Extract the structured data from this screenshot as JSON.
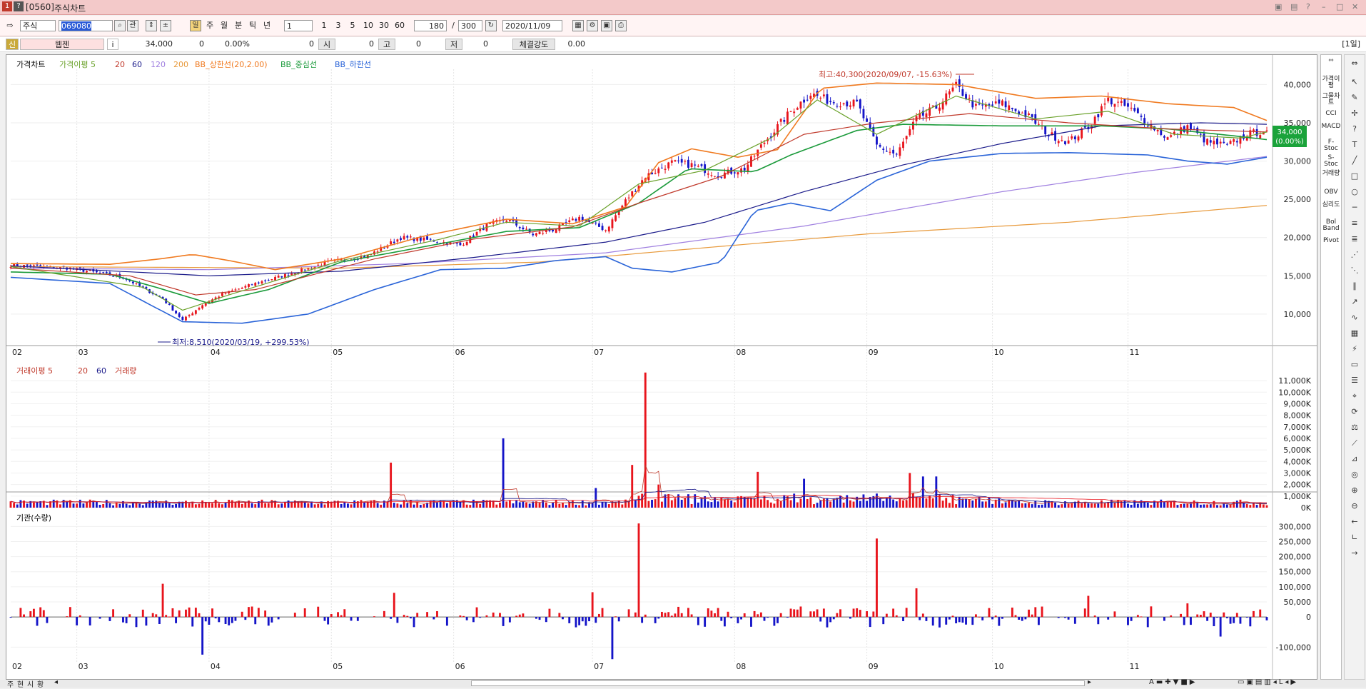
{
  "window": {
    "screen_no": "[0560]",
    "title": "주식차트",
    "sys_icon_1": "1",
    "sys_icon_2": "?"
  },
  "toolbar": {
    "market_select": "주식",
    "code_input": "069080",
    "btn_gwan": "관",
    "period_buttons": [
      "일",
      "주",
      "월",
      "분",
      "틱",
      "년"
    ],
    "interval_value": "1",
    "minute_buttons": [
      "1",
      "3",
      "5",
      "10",
      "30",
      "60"
    ],
    "count_value": "180",
    "count_sep": "/",
    "total_value": "300",
    "date_value": "2020/11/09"
  },
  "infobar": {
    "badge": "신",
    "stock_name": "웹젠",
    "info_icon": "i",
    "price": "34,000",
    "change": "0",
    "change_rate": "0.00%",
    "volume": "0",
    "open_label": "시",
    "open_value": "0",
    "high_label": "고",
    "high_value": "0",
    "low_label": "저",
    "low_value": "0",
    "strength_label": "체결강도",
    "strength_value": "0.00",
    "period_tag": "[1일]"
  },
  "legend": {
    "price": [
      "가격차트",
      "가격이평 5",
      "20",
      "60",
      "120",
      "200",
      "BB_상한선(20,2.00)",
      "BB_중심선",
      "BB_하한선"
    ],
    "volume": [
      "거래이평 5",
      "20",
      "60",
      "거래량"
    ],
    "inst": [
      "기관(수량)"
    ]
  },
  "annotations": {
    "high": "최고:40,300(2020/09/07, -15.63%)",
    "low": "최저:8,510(2020/03/19, +299.53%)"
  },
  "price_badge": {
    "value": "34,000",
    "pct": "(0.00%)"
  },
  "right_panel": [
    "가격이평",
    "그물차트",
    "CCI",
    "MACD",
    "F-Stoc",
    "S-Stoc",
    "거래량",
    "OBV",
    "심리도",
    "Bol Band",
    "Pivot"
  ],
  "statusbar": {
    "tabs": [
      "주",
      "현",
      "시",
      "황"
    ]
  },
  "colors": {
    "up": "#e8141c",
    "down": "#1414c8",
    "ma5": "#6aa12a",
    "ma20": "#c0392b",
    "ma60": "#1a1a8a",
    "ma120": "#a080e0",
    "ma200": "#e89a3c",
    "bb_upper": "#f07a20",
    "bb_mid": "#1a9a3a",
    "bb_lower": "#2a64d8"
  },
  "chart_data": [
    {
      "type": "candlestick",
      "title": "가격차트",
      "x_months": [
        "02",
        "03",
        "04",
        "05",
        "06",
        "07",
        "08",
        "09",
        "10",
        "11"
      ],
      "y_ticks": [
        10000,
        15000,
        20000,
        25000,
        30000,
        35000,
        40000
      ],
      "ylim": [
        7000,
        42000
      ],
      "last_close": 34000,
      "high": {
        "value": 40300,
        "date": "2020/09/07"
      },
      "low": {
        "value": 8510,
        "date": "2020/03/19"
      },
      "close_anchors": [
        [
          0,
          16400
        ],
        [
          18,
          16000
        ],
        [
          34,
          14800
        ],
        [
          46,
          12000
        ],
        [
          52,
          9200
        ],
        [
          58,
          11200
        ],
        [
          64,
          12600
        ],
        [
          74,
          14000
        ],
        [
          84,
          15200
        ],
        [
          96,
          16800
        ],
        [
          108,
          17600
        ],
        [
          118,
          20000
        ],
        [
          128,
          19600
        ],
        [
          136,
          19000
        ],
        [
          144,
          21600
        ],
        [
          150,
          22400
        ],
        [
          158,
          20400
        ],
        [
          164,
          21000
        ],
        [
          172,
          22600
        ],
        [
          180,
          21000
        ],
        [
          186,
          24800
        ],
        [
          192,
          28000
        ],
        [
          200,
          29800
        ],
        [
          206,
          29500
        ],
        [
          214,
          28200
        ],
        [
          222,
          29000
        ],
        [
          228,
          32500
        ],
        [
          236,
          36500
        ],
        [
          242,
          38800
        ],
        [
          248,
          37800
        ],
        [
          256,
          37500
        ],
        [
          262,
          32000
        ],
        [
          268,
          30800
        ],
        [
          274,
          35500
        ],
        [
          280,
          37000
        ],
        [
          286,
          39800
        ],
        [
          292,
          37000
        ],
        [
          300,
          37500
        ],
        [
          308,
          35800
        ],
        [
          314,
          33500
        ],
        [
          320,
          32500
        ],
        [
          326,
          34500
        ],
        [
          332,
          38000
        ],
        [
          338,
          37000
        ],
        [
          344,
          35000
        ],
        [
          350,
          33000
        ],
        [
          356,
          34500
        ],
        [
          362,
          32500
        ],
        [
          368,
          32000
        ],
        [
          374,
          33500
        ],
        [
          380,
          34000
        ]
      ],
      "ma": {
        "ma5": [
          [
            0,
            16200
          ],
          [
            40,
            13500
          ],
          [
            52,
            10500
          ],
          [
            66,
            12500
          ],
          [
            100,
            17000
          ],
          [
            130,
            19800
          ],
          [
            150,
            22000
          ],
          [
            172,
            21500
          ],
          [
            190,
            27000
          ],
          [
            210,
            28800
          ],
          [
            230,
            33000
          ],
          [
            244,
            38000
          ],
          [
            262,
            33500
          ],
          [
            286,
            38500
          ],
          [
            310,
            35500
          ],
          [
            332,
            36500
          ],
          [
            352,
            33500
          ],
          [
            372,
            33000
          ],
          [
            380,
            33800
          ]
        ],
        "ma20": [
          [
            0,
            16000
          ],
          [
            36,
            15000
          ],
          [
            56,
            12500
          ],
          [
            74,
            13200
          ],
          [
            110,
            17200
          ],
          [
            140,
            19800
          ],
          [
            170,
            21400
          ],
          [
            190,
            24500
          ],
          [
            215,
            28000
          ],
          [
            240,
            33500
          ],
          [
            262,
            35000
          ],
          [
            290,
            36200
          ],
          [
            320,
            35000
          ],
          [
            350,
            34200
          ],
          [
            380,
            33800
          ]
        ],
        "ma60": [
          [
            0,
            16300
          ],
          [
            60,
            15000
          ],
          [
            100,
            15600
          ],
          [
            140,
            17400
          ],
          [
            180,
            19400
          ],
          [
            210,
            22000
          ],
          [
            240,
            26000
          ],
          [
            270,
            29500
          ],
          [
            300,
            32300
          ],
          [
            330,
            34600
          ],
          [
            360,
            35000
          ],
          [
            380,
            34800
          ]
        ],
        "ma120": [
          [
            0,
            16000
          ],
          [
            60,
            15800
          ],
          [
            120,
            16600
          ],
          [
            180,
            18000
          ],
          [
            240,
            21500
          ],
          [
            300,
            26000
          ],
          [
            340,
            28500
          ],
          [
            380,
            30600
          ]
        ],
        "ma200": [
          [
            0,
            16200
          ],
          [
            100,
            16000
          ],
          [
            160,
            16800
          ],
          [
            200,
            18300
          ],
          [
            260,
            20500
          ],
          [
            320,
            22000
          ],
          [
            380,
            24200
          ]
        ],
        "bb_upper": [
          [
            0,
            16600
          ],
          [
            30,
            16500
          ],
          [
            45,
            17200
          ],
          [
            55,
            17800
          ],
          [
            66,
            17000
          ],
          [
            80,
            15800
          ],
          [
            100,
            17200
          ],
          [
            125,
            20200
          ],
          [
            150,
            22400
          ],
          [
            170,
            21800
          ],
          [
            186,
            24000
          ],
          [
            196,
            29800
          ],
          [
            206,
            31600
          ],
          [
            220,
            30500
          ],
          [
            232,
            31500
          ],
          [
            245,
            39500
          ],
          [
            262,
            40200
          ],
          [
            286,
            40000
          ],
          [
            310,
            38200
          ],
          [
            330,
            38500
          ],
          [
            350,
            37500
          ],
          [
            370,
            37000
          ],
          [
            380,
            35300
          ]
        ],
        "bb_mid": [
          [
            0,
            15500
          ],
          [
            30,
            15200
          ],
          [
            44,
            13500
          ],
          [
            60,
            11400
          ],
          [
            78,
            13200
          ],
          [
            100,
            16800
          ],
          [
            125,
            18800
          ],
          [
            150,
            20800
          ],
          [
            172,
            21300
          ],
          [
            190,
            24500
          ],
          [
            205,
            29000
          ],
          [
            225,
            28600
          ],
          [
            236,
            30800
          ],
          [
            256,
            34000
          ],
          [
            270,
            34800
          ],
          [
            300,
            34600
          ],
          [
            330,
            34600
          ],
          [
            350,
            34200
          ],
          [
            370,
            33300
          ],
          [
            380,
            32800
          ]
        ],
        "bb_lower": [
          [
            0,
            14800
          ],
          [
            30,
            14000
          ],
          [
            44,
            10800
          ],
          [
            52,
            9000
          ],
          [
            70,
            8800
          ],
          [
            90,
            10000
          ],
          [
            110,
            13200
          ],
          [
            130,
            15800
          ],
          [
            150,
            16000
          ],
          [
            165,
            17000
          ],
          [
            180,
            17500
          ],
          [
            188,
            16000
          ],
          [
            200,
            15500
          ],
          [
            215,
            16800
          ],
          [
            225,
            23500
          ],
          [
            236,
            24500
          ],
          [
            248,
            23500
          ],
          [
            262,
            27500
          ],
          [
            278,
            30000
          ],
          [
            300,
            31000
          ],
          [
            320,
            31100
          ],
          [
            344,
            30800
          ],
          [
            356,
            30000
          ],
          [
            368,
            29600
          ],
          [
            380,
            30500
          ]
        ]
      }
    },
    {
      "type": "bar",
      "title": "거래량",
      "x_months": [
        "02",
        "03",
        "04",
        "05",
        "06",
        "07",
        "08",
        "09",
        "10",
        "11"
      ],
      "y_ticks": [
        "11,000K",
        "10,000K",
        "9,000K",
        "8,000K",
        "7,000K",
        "6,000K",
        "5,000K",
        "4,000K",
        "3,000K",
        "2,000K",
        "1,000K",
        "0K"
      ],
      "ylim": [
        0,
        11500
      ],
      "spikes": [
        [
          115,
          3900
        ],
        [
          149,
          6000
        ],
        [
          177,
          1700
        ],
        [
          188,
          3700
        ],
        [
          192,
          11700
        ],
        [
          196,
          2000
        ],
        [
          226,
          3100
        ],
        [
          240,
          2500
        ],
        [
          272,
          3000
        ],
        [
          276,
          2700
        ],
        [
          280,
          2700
        ]
      ]
    },
    {
      "type": "bar",
      "title": "기관(수량)",
      "x_months": [
        "02",
        "03",
        "04",
        "05",
        "06",
        "07",
        "08",
        "09",
        "10",
        "11"
      ],
      "y_ticks": [
        "300,000",
        "250,000",
        "200,000",
        "150,000",
        "100,000",
        "50,000",
        "0",
        "-100,000"
      ],
      "ylim": [
        -130000,
        315000
      ],
      "spikes": [
        [
          46,
          110000
        ],
        [
          58,
          -125000
        ],
        [
          116,
          80000
        ],
        [
          176,
          82000
        ],
        [
          182,
          -140000
        ],
        [
          190,
          310000
        ],
        [
          262,
          260000
        ],
        [
          274,
          95000
        ],
        [
          326,
          70000
        ],
        [
          356,
          45000
        ],
        [
          366,
          -65000
        ]
      ]
    }
  ]
}
